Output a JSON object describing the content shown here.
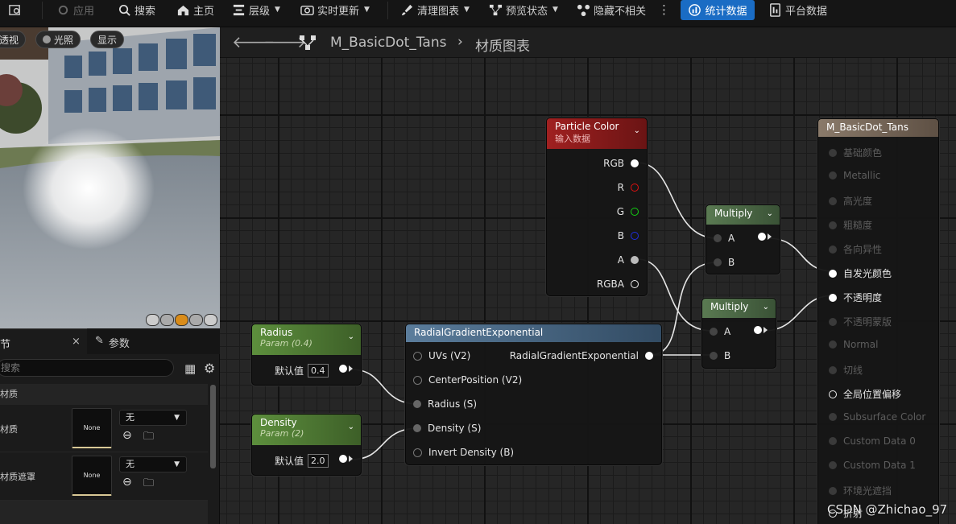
{
  "toolbar": {
    "apply": "应用",
    "search": "搜索",
    "home": "主页",
    "hierarchy": "层级",
    "live_update": "实时更新",
    "clean_graph": "清理图表",
    "preview_state": "预览状态",
    "hide_unrelated": "隐藏不相关",
    "stats": "统计数据",
    "platform_stats": "平台数据"
  },
  "viewport": {
    "perspective": "透视",
    "lit": "光照",
    "show": "显示"
  },
  "details": {
    "tab_details": "节",
    "tab_params": "参数",
    "close": "×",
    "search_placeholder": "搜索",
    "category": "材质",
    "row1_label": "材质",
    "row2_label": "材质遮罩",
    "thumb_none": "None",
    "combo_value": "无"
  },
  "breadcrumb": {
    "asset": "M_BasicDot_Tans",
    "graph": "材质图表"
  },
  "nodes": {
    "particle_color": {
      "title": "Particle Color",
      "subtitle": "输入数据",
      "pins": [
        "RGB",
        "R",
        "G",
        "B",
        "A",
        "RGBA"
      ]
    },
    "multiply1": {
      "title": "Multiply",
      "a": "A",
      "b": "B"
    },
    "multiply2": {
      "title": "Multiply",
      "a": "A",
      "b": "B"
    },
    "radius": {
      "title": "Radius",
      "subtitle": "Param (0.4)",
      "default_label": "默认值",
      "value": "0.4"
    },
    "density": {
      "title": "Density",
      "subtitle": "Param (2)",
      "default_label": "默认值",
      "value": "2.0"
    },
    "radial": {
      "title": "RadialGradientExponential",
      "inputs": [
        "UVs (V2)",
        "CenterPosition (V2)",
        "Radius (S)",
        "Density (S)",
        "Invert Density (B)"
      ],
      "output": "RadialGradientExponential"
    },
    "material": {
      "title": "M_BasicDot_Tans",
      "pins": [
        "基础颜色",
        "Metallic",
        "高光度",
        "粗糙度",
        "各向异性",
        "自发光颜色",
        "不透明度",
        "不透明蒙版",
        "Normal",
        "切线",
        "全局位置偏移",
        "Subsurface Color",
        "Custom Data 0",
        "Custom Data 1",
        "环境光遮挡",
        "折射"
      ]
    }
  },
  "watermark": "CSDN @Zhichao_97"
}
